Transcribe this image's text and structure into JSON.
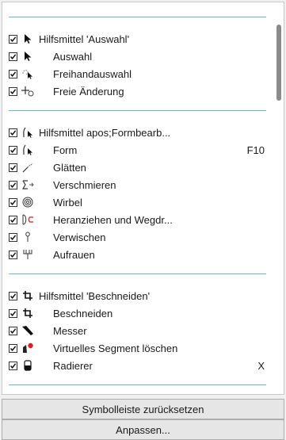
{
  "groups": [
    {
      "header": {
        "label": "Hilfsmittel 'Auswahl'",
        "icon": "pick-arrow-icon",
        "checked": true
      },
      "items": [
        {
          "label": "Auswahl",
          "icon": "pick-arrow-icon",
          "checked": true,
          "shortcut": ""
        },
        {
          "label": "Freihandauswahl",
          "icon": "freehand-pick-icon",
          "checked": true,
          "shortcut": ""
        },
        {
          "label": "Freie Änderung",
          "icon": "free-transform-icon",
          "checked": true,
          "shortcut": ""
        }
      ]
    },
    {
      "header": {
        "label": "Hilfsmittel apos;Formbearb...",
        "icon": "shape-tool-icon",
        "checked": true
      },
      "items": [
        {
          "label": "Form",
          "icon": "shape-tool-icon",
          "checked": true,
          "shortcut": "F10"
        },
        {
          "label": "Glätten",
          "icon": "smooth-icon",
          "checked": true,
          "shortcut": ""
        },
        {
          "label": "Verschmieren",
          "icon": "smear-icon",
          "checked": true,
          "shortcut": ""
        },
        {
          "label": "Wirbel",
          "icon": "twirl-icon",
          "checked": true,
          "shortcut": ""
        },
        {
          "label": "Heranziehen und Wegdr...",
          "icon": "attract-repel-icon",
          "checked": true,
          "shortcut": ""
        },
        {
          "label": "Verwischen",
          "icon": "smudge-icon",
          "checked": true,
          "shortcut": ""
        },
        {
          "label": "Aufrauen",
          "icon": "roughen-icon",
          "checked": true,
          "shortcut": ""
        }
      ]
    },
    {
      "header": {
        "label": "Hilfsmittel 'Beschneiden'",
        "icon": "crop-icon",
        "checked": true
      },
      "items": [
        {
          "label": "Beschneiden",
          "icon": "crop-icon",
          "checked": true,
          "shortcut": ""
        },
        {
          "label": "Messer",
          "icon": "knife-icon",
          "checked": true,
          "shortcut": ""
        },
        {
          "label": "Virtuelles Segment löschen",
          "icon": "virtual-segment-delete-icon",
          "checked": true,
          "shortcut": ""
        },
        {
          "label": "Radierer",
          "icon": "eraser-icon",
          "checked": true,
          "shortcut": "X"
        }
      ]
    }
  ],
  "buttons": {
    "reset": "Symbolleiste zurücksetzen",
    "customize": "Anpassen..."
  },
  "colors": {
    "separator": "#5bb8e0",
    "panel_bg": "#ffffff",
    "window_bg": "#f0f0f0",
    "red_dot": "#e02020"
  }
}
